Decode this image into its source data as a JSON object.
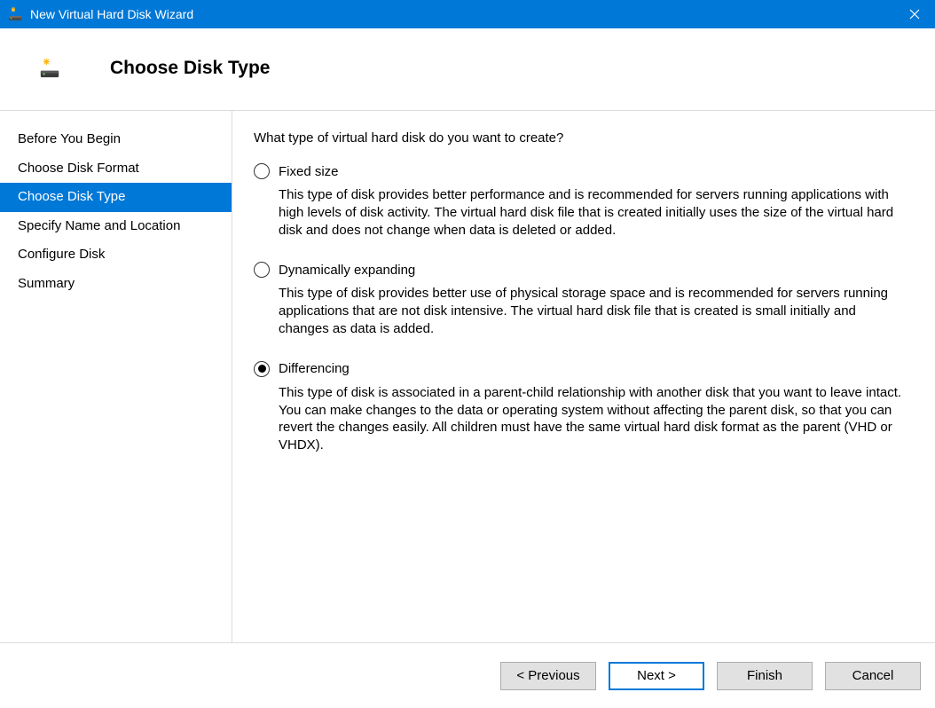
{
  "titlebar": {
    "title": "New Virtual Hard Disk Wizard"
  },
  "header": {
    "title": "Choose Disk Type"
  },
  "sidebar": {
    "steps": [
      {
        "label": "Before You Begin",
        "active": false
      },
      {
        "label": "Choose Disk Format",
        "active": false
      },
      {
        "label": "Choose Disk Type",
        "active": true
      },
      {
        "label": "Specify Name and Location",
        "active": false
      },
      {
        "label": "Configure Disk",
        "active": false
      },
      {
        "label": "Summary",
        "active": false
      }
    ]
  },
  "main": {
    "question": "What type of virtual hard disk do you want to create?",
    "options": [
      {
        "label": "Fixed size",
        "checked": false,
        "desc": "This type of disk provides better performance and is recommended for servers running applications with high levels of disk activity. The virtual hard disk file that is created initially uses the size of the virtual hard disk and does not change when data is deleted or added."
      },
      {
        "label": "Dynamically expanding",
        "checked": false,
        "desc": "This type of disk provides better use of physical storage space and is recommended for servers running applications that are not disk intensive. The virtual hard disk file that is created is small initially and changes as data is added."
      },
      {
        "label": "Differencing",
        "checked": true,
        "desc": "This type of disk is associated in a parent-child relationship with another disk that you want to leave intact. You can make changes to the data or operating system without affecting the parent disk, so that you can revert the changes easily. All children must have the same virtual hard disk format as the parent (VHD or VHDX)."
      }
    ]
  },
  "footer": {
    "previous": "< Previous",
    "next": "Next >",
    "finish": "Finish",
    "cancel": "Cancel"
  }
}
